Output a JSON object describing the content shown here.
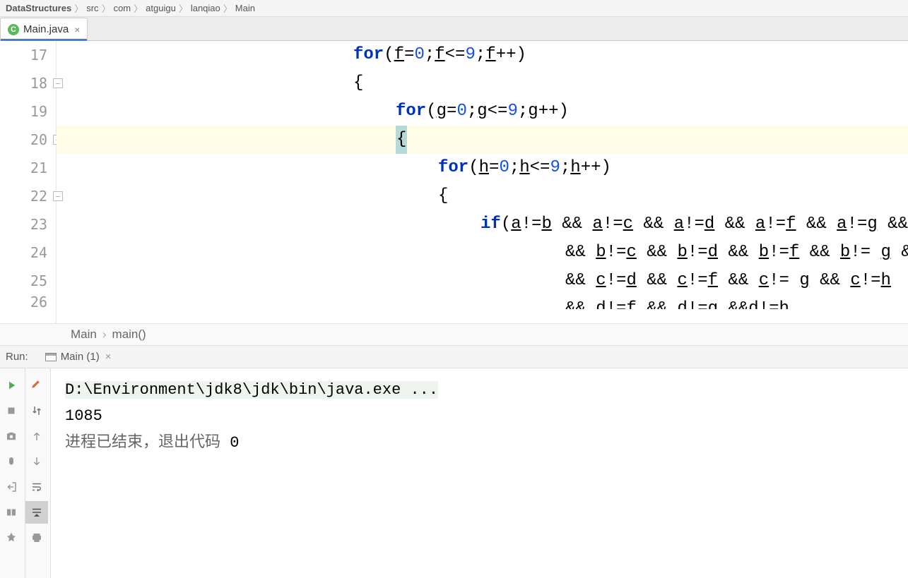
{
  "breadcrumb": {
    "items": [
      "DataStructures",
      "src",
      "com",
      "atguigu",
      "lanqiao",
      "Main"
    ]
  },
  "tabs": {
    "active": {
      "label": "Main.java",
      "icon": "C"
    }
  },
  "editor": {
    "lines": [
      {
        "num": 17,
        "indent": 7,
        "tokens": [
          {
            "t": "kw",
            "s": "for"
          },
          {
            "t": "op",
            "s": "("
          },
          {
            "t": "var",
            "s": "f"
          },
          {
            "t": "op",
            "s": "="
          },
          {
            "t": "num",
            "s": "0"
          },
          {
            "t": "op",
            "s": ";"
          },
          {
            "t": "var",
            "s": "f"
          },
          {
            "t": "op",
            "s": "<="
          },
          {
            "t": "num",
            "s": "9"
          },
          {
            "t": "op",
            "s": ";"
          },
          {
            "t": "var",
            "s": "f"
          },
          {
            "t": "op",
            "s": "++)"
          }
        ]
      },
      {
        "num": 18,
        "indent": 7,
        "fold": true,
        "tokens": [
          {
            "t": "brace",
            "s": "{"
          }
        ]
      },
      {
        "num": 19,
        "indent": 8,
        "tokens": [
          {
            "t": "kw",
            "s": "for"
          },
          {
            "t": "op",
            "s": "("
          },
          {
            "t": "var",
            "s": "g"
          },
          {
            "t": "op",
            "s": "="
          },
          {
            "t": "num",
            "s": "0"
          },
          {
            "t": "op",
            "s": ";"
          },
          {
            "t": "var",
            "s": "g"
          },
          {
            "t": "op",
            "s": "<="
          },
          {
            "t": "num",
            "s": "9"
          },
          {
            "t": "op",
            "s": ";"
          },
          {
            "t": "var",
            "s": "g"
          },
          {
            "t": "op",
            "s": "++)"
          }
        ]
      },
      {
        "num": 20,
        "indent": 8,
        "fold": true,
        "current": true,
        "tokens": [
          {
            "t": "cursor",
            "s": "{"
          },
          {
            "t": "op",
            "s": ""
          }
        ]
      },
      {
        "num": 21,
        "indent": 9,
        "tokens": [
          {
            "t": "kw",
            "s": "for"
          },
          {
            "t": "op",
            "s": "("
          },
          {
            "t": "var",
            "s": "h"
          },
          {
            "t": "op",
            "s": "="
          },
          {
            "t": "num",
            "s": "0"
          },
          {
            "t": "op",
            "s": ";"
          },
          {
            "t": "var",
            "s": "h"
          },
          {
            "t": "op",
            "s": "<="
          },
          {
            "t": "num",
            "s": "9"
          },
          {
            "t": "op",
            "s": ";"
          },
          {
            "t": "var",
            "s": "h"
          },
          {
            "t": "op",
            "s": "++)"
          }
        ]
      },
      {
        "num": 22,
        "indent": 9,
        "fold": true,
        "tokens": [
          {
            "t": "brace",
            "s": "{"
          }
        ]
      },
      {
        "num": 23,
        "indent": 10,
        "tokens": [
          {
            "t": "kw",
            "s": "if"
          },
          {
            "t": "op",
            "s": "("
          },
          {
            "t": "var",
            "s": "a"
          },
          {
            "t": "op",
            "s": "!="
          },
          {
            "t": "var",
            "s": "b"
          },
          {
            "t": "op",
            "s": " && "
          },
          {
            "t": "var",
            "s": "a"
          },
          {
            "t": "op",
            "s": "!="
          },
          {
            "t": "var",
            "s": "c"
          },
          {
            "t": "op",
            "s": " && "
          },
          {
            "t": "var",
            "s": "a"
          },
          {
            "t": "op",
            "s": "!="
          },
          {
            "t": "var",
            "s": "d"
          },
          {
            "t": "op",
            "s": " && "
          },
          {
            "t": "var",
            "s": "a"
          },
          {
            "t": "op",
            "s": "!="
          },
          {
            "t": "var",
            "s": "f"
          },
          {
            "t": "op",
            "s": " && "
          },
          {
            "t": "var",
            "s": "a"
          },
          {
            "t": "op",
            "s": "!="
          },
          {
            "t": "var",
            "s": "g"
          },
          {
            "t": "op",
            "s": " &&"
          }
        ]
      },
      {
        "num": 24,
        "indent": 12,
        "tokens": [
          {
            "t": "op",
            "s": "&& "
          },
          {
            "t": "var",
            "s": "b"
          },
          {
            "t": "op",
            "s": "!="
          },
          {
            "t": "var",
            "s": "c"
          },
          {
            "t": "op",
            "s": " && "
          },
          {
            "t": "var",
            "s": "b"
          },
          {
            "t": "op",
            "s": "!="
          },
          {
            "t": "var",
            "s": "d"
          },
          {
            "t": "op",
            "s": " && "
          },
          {
            "t": "var",
            "s": "b"
          },
          {
            "t": "op",
            "s": "!="
          },
          {
            "t": "var",
            "s": "f"
          },
          {
            "t": "op",
            "s": " && "
          },
          {
            "t": "var",
            "s": "b"
          },
          {
            "t": "op",
            "s": "!= "
          },
          {
            "t": "var",
            "s": "g"
          },
          {
            "t": "op",
            "s": " &&"
          }
        ]
      },
      {
        "num": 25,
        "indent": 12,
        "tokens": [
          {
            "t": "op",
            "s": "&& "
          },
          {
            "t": "var",
            "s": "c"
          },
          {
            "t": "op",
            "s": "!="
          },
          {
            "t": "var",
            "s": "d"
          },
          {
            "t": "op",
            "s": " && "
          },
          {
            "t": "var",
            "s": "c"
          },
          {
            "t": "op",
            "s": "!="
          },
          {
            "t": "var",
            "s": "f"
          },
          {
            "t": "op",
            "s": " && "
          },
          {
            "t": "var",
            "s": "c"
          },
          {
            "t": "op",
            "s": "!= "
          },
          {
            "t": "var",
            "s": "g"
          },
          {
            "t": "op",
            "s": " && "
          },
          {
            "t": "var",
            "s": "c"
          },
          {
            "t": "op",
            "s": "!="
          },
          {
            "t": "var",
            "s": "h"
          }
        ]
      },
      {
        "num": 26,
        "indent": 12,
        "partial": true,
        "tokens": [
          {
            "t": "op",
            "s": "&& "
          },
          {
            "t": "var",
            "s": "d"
          },
          {
            "t": "op",
            "s": "!="
          },
          {
            "t": "var",
            "s": "f"
          },
          {
            "t": "op",
            "s": " && "
          },
          {
            "t": "var",
            "s": "d"
          },
          {
            "t": "op",
            "s": "!="
          },
          {
            "t": "var",
            "s": "g"
          },
          {
            "t": "op",
            "s": " &&"
          },
          {
            "t": "var",
            "s": "d"
          },
          {
            "t": "op",
            "s": "!="
          },
          {
            "t": "var",
            "s": "h"
          }
        ]
      }
    ]
  },
  "navCrumb": {
    "class": "Main",
    "method": "main()"
  },
  "runTool": {
    "label": "Run:",
    "tabLabel": "Main (1)"
  },
  "console": {
    "cmd": "D:\\Environment\\jdk8\\jdk\\bin\\java.exe ...",
    "output": "1085",
    "exitMsg": "进程已结束，退出代码 ",
    "exitCode": "0"
  }
}
